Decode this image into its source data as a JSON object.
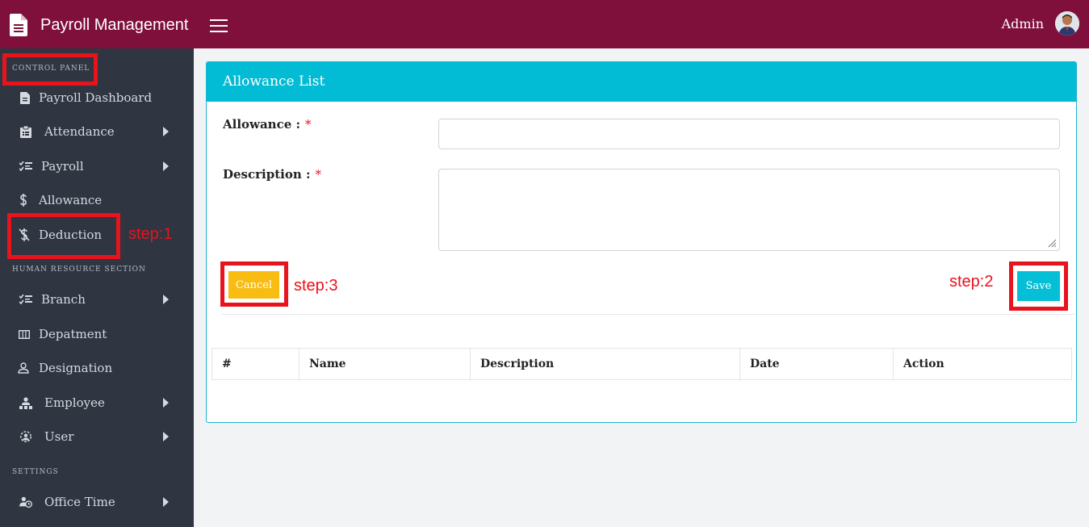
{
  "header": {
    "title": "Payroll Management",
    "user_name": "Admin",
    "brand_icon": "file-icon",
    "menu_icon": "hamburger-icon",
    "color": "#7f103c"
  },
  "sidebar": {
    "sections": {
      "control_panel": "CONTROL PANEL",
      "human_resource": "HUMAN RESOURCE SECTION",
      "settings": "SETTINGS"
    },
    "items": [
      {
        "label": "Payroll Dashboard",
        "icon": "file-icon",
        "submenu": false
      },
      {
        "label": "Attendance",
        "icon": "clipboard-icon",
        "submenu": true
      },
      {
        "label": "Payroll",
        "icon": "list-check-icon",
        "submenu": true
      },
      {
        "label": "Allowance",
        "icon": "dollar-icon",
        "submenu": false
      },
      {
        "label": "Deduction",
        "icon": "dollar-slash-icon",
        "submenu": false
      },
      {
        "label": "Branch",
        "icon": "list-check-icon",
        "submenu": true
      },
      {
        "label": "Depatment",
        "icon": "columns-icon",
        "submenu": false
      },
      {
        "label": "Designation",
        "icon": "user-icon",
        "submenu": false
      },
      {
        "label": "Employee",
        "icon": "sitemap-icon",
        "submenu": true
      },
      {
        "label": "User",
        "icon": "user-cog-icon",
        "submenu": true
      },
      {
        "label": "Office Time",
        "icon": "user-clock-icon",
        "submenu": true
      }
    ],
    "color": "#2f3541"
  },
  "annotations": {
    "step1": "step:1",
    "step2": "step:2",
    "step3": "step:3",
    "color": "#e8131d"
  },
  "card": {
    "title": "Allowance List",
    "accent": "#02bbd4",
    "form": {
      "allowance_label": "Allowance :",
      "description_label": "Description :",
      "required_mark": "*",
      "allowance_value": "",
      "description_value": ""
    },
    "buttons": {
      "cancel": "Cancel",
      "save": "Save"
    },
    "table": {
      "columns": [
        "#",
        "Name",
        "Description",
        "Date",
        "Action"
      ]
    }
  }
}
